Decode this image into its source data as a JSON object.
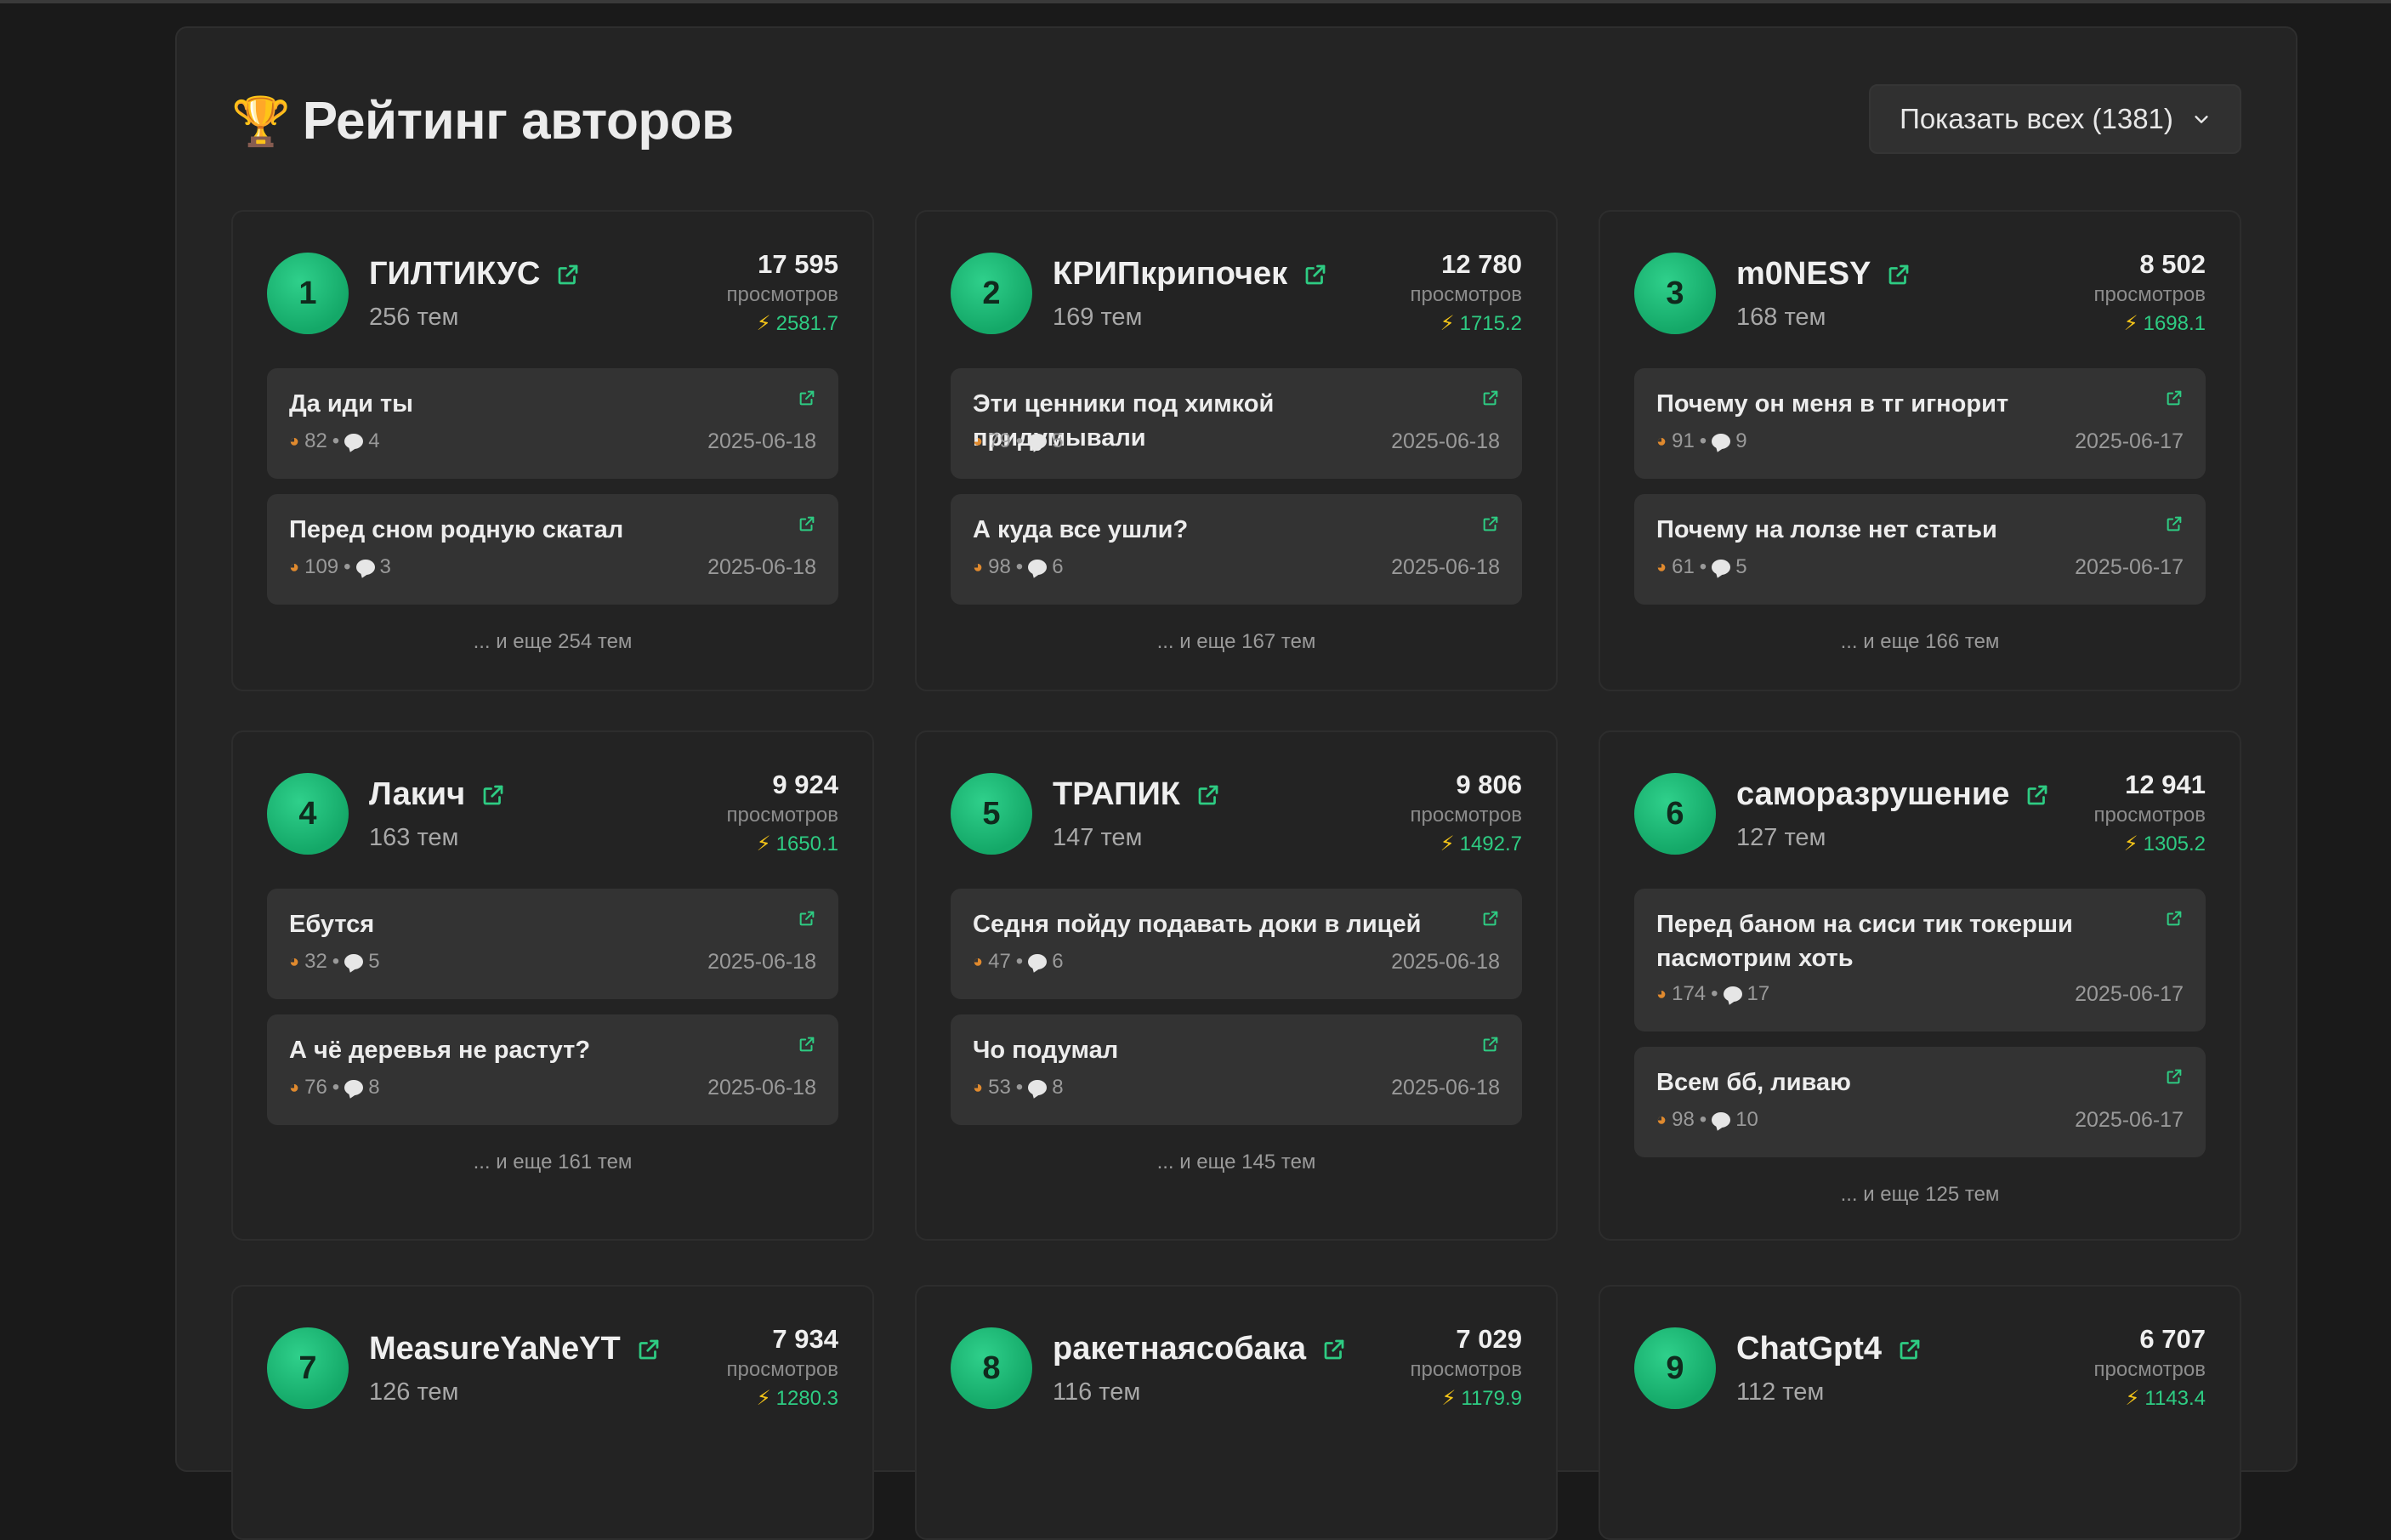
{
  "header": {
    "title": "Рейтинг авторов",
    "show_all_label": "Показать всех (1381)"
  },
  "authors": [
    {
      "rank": "1",
      "name": "ГИЛТИКУС",
      "topics": "256 тем",
      "views": "17 595",
      "views_label": "просмотров",
      "score": "2581.7",
      "posts": [
        {
          "title": "Да иди ты",
          "views": "82",
          "comments": "4",
          "date": "2025-06-18"
        },
        {
          "title": "Перед сном родную скатал",
          "views": "109",
          "comments": "3",
          "date": "2025-06-18"
        }
      ],
      "more": "... и еще 254 тем"
    },
    {
      "rank": "2",
      "name": "КРИПкрипочек",
      "topics": "169 тем",
      "views": "12 780",
      "views_label": "просмотров",
      "score": "1715.2",
      "posts": [
        {
          "title": "Эти ценники под химкой придумывали",
          "views": "79",
          "comments": "5",
          "date": "2025-06-18"
        },
        {
          "title": "А куда все ушли?",
          "views": "98",
          "comments": "6",
          "date": "2025-06-18"
        }
      ],
      "more": "... и еще 167 тем"
    },
    {
      "rank": "3",
      "name": "m0NESY",
      "topics": "168 тем",
      "views": "8 502",
      "views_label": "просмотров",
      "score": "1698.1",
      "posts": [
        {
          "title": "Почему он меня в тг игнорит",
          "views": "91",
          "comments": "9",
          "date": "2025-06-17"
        },
        {
          "title": "Почему на лолзе нет статьи",
          "views": "61",
          "comments": "5",
          "date": "2025-06-17"
        }
      ],
      "more": "... и еще 166 тем"
    },
    {
      "rank": "4",
      "name": "Лакич",
      "topics": "163 тем",
      "views": "9 924",
      "views_label": "просмотров",
      "score": "1650.1",
      "posts": [
        {
          "title": "Ебутся",
          "views": "32",
          "comments": "5",
          "date": "2025-06-18"
        },
        {
          "title": "А чё деревья не растут?",
          "views": "76",
          "comments": "8",
          "date": "2025-06-18"
        }
      ],
      "more": "... и еще 161 тем"
    },
    {
      "rank": "5",
      "name": "ТРАПИК",
      "topics": "147 тем",
      "views": "9 806",
      "views_label": "просмотров",
      "score": "1492.7",
      "posts": [
        {
          "title": "Седня пойду подавать доки в лицей",
          "views": "47",
          "comments": "6",
          "date": "2025-06-18"
        },
        {
          "title": "Чо подумал",
          "views": "53",
          "comments": "8",
          "date": "2025-06-18"
        }
      ],
      "more": "... и еще 145 тем"
    },
    {
      "rank": "6",
      "name": "саморазрушение",
      "topics": "127 тем",
      "views": "12 941",
      "views_label": "просмотров",
      "score": "1305.2",
      "posts": [
        {
          "title": "Перед баном на сиси тик токерши пасмотрим хоть",
          "views": "174",
          "comments": "17",
          "date": "2025-06-17"
        },
        {
          "title": "Всем бб, ливаю",
          "views": "98",
          "comments": "10",
          "date": "2025-06-17"
        }
      ],
      "more": "... и еще 125 тем"
    },
    {
      "rank": "7",
      "name": "MeasureYaNeYT",
      "topics": "126 тем",
      "views": "7 934",
      "views_label": "просмотров",
      "score": "1280.3",
      "posts": [],
      "more": ""
    },
    {
      "rank": "8",
      "name": "ракетнаясобака",
      "topics": "116 тем",
      "views": "7 029",
      "views_label": "просмотров",
      "score": "1179.9",
      "posts": [],
      "more": ""
    },
    {
      "rank": "9",
      "name": "ChatGpt4",
      "topics": "112 тем",
      "views": "6 707",
      "views_label": "просмотров",
      "score": "1143.4",
      "posts": [],
      "more": ""
    }
  ],
  "colors": {
    "accent_green": "#2ecc83",
    "bolt_yellow": "#f5c518",
    "background": "#1a1a1a",
    "panel": "#242424",
    "post_bg": "#333333"
  },
  "icons": {
    "title": "trophy-icon",
    "external": "external-link-icon",
    "views": "eye-icon",
    "comments": "comment-bubble-icon",
    "score": "lightning-icon",
    "dropdown": "chevron-down-icon"
  }
}
